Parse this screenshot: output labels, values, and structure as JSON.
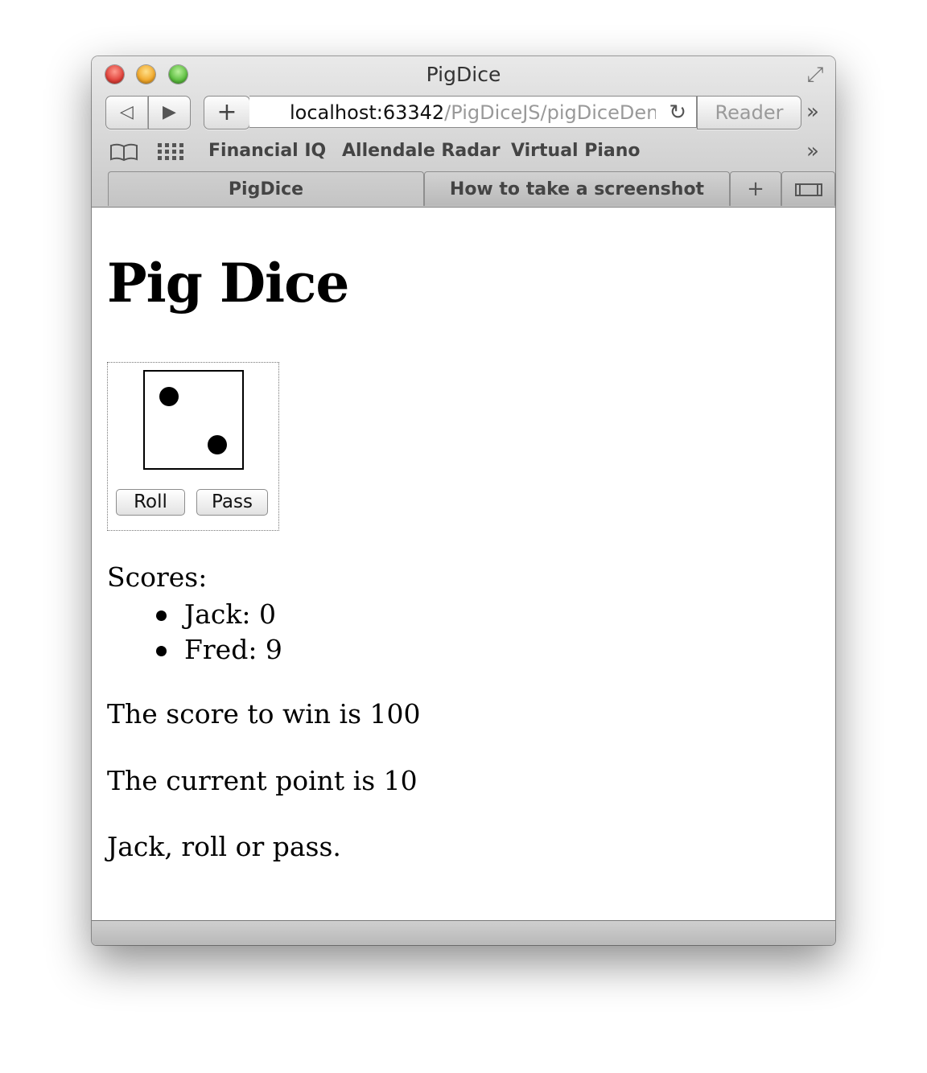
{
  "window": {
    "title": "PigDice",
    "traffic_lights": [
      "close",
      "minimize",
      "zoom"
    ]
  },
  "toolbar": {
    "back_icon": "◁",
    "forward_icon": "▶",
    "add_icon": "+",
    "url_host": "localhost:63342",
    "url_path": "/PigDiceJS/pigDiceDen",
    "reload_icon": "↻",
    "reader_label": "Reader",
    "more_icon": "»"
  },
  "bookmarks": {
    "book_icon": "📖",
    "grid_icon": "▦",
    "items": [
      "Financial IQ",
      "Allendale Radar",
      "Virtual Piano"
    ],
    "more_icon": "»"
  },
  "tabs": {
    "items": [
      {
        "label": "PigDice",
        "active": true
      },
      {
        "label": "How to take a screenshot",
        "active": false
      }
    ],
    "new_tab_icon": "+",
    "tab_view_icon": "▭"
  },
  "page": {
    "title": "Pig Dice",
    "die_value": 2,
    "roll_label": "Roll",
    "pass_label": "Pass",
    "scores_label": "Scores:",
    "scores": [
      {
        "text": "Jack: 0"
      },
      {
        "text": "Fred: 9"
      }
    ],
    "win_text": "The score to win is 100",
    "point_text": "The current point is 10",
    "prompt_text": "Jack, roll or pass."
  }
}
